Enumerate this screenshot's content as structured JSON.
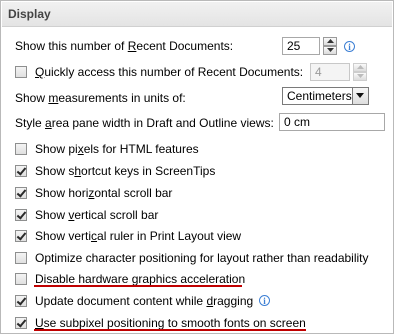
{
  "header": {
    "title": "Display"
  },
  "recent_docs": {
    "label_pre": "Show this number of ",
    "label_u": "R",
    "label_post": "ecent Documents:",
    "value": "25"
  },
  "quick_access": {
    "label_u": "Q",
    "label_post": "uickly access this number of Recent Documents:",
    "value": "4",
    "checked": false
  },
  "measurements": {
    "label_pre": "Show ",
    "label_u": "m",
    "label_post": "easurements in units of:",
    "selected": "Centimeters"
  },
  "style_area": {
    "label_pre": "Style ",
    "label_u": "a",
    "label_post": "rea pane width in Draft and Outline views:",
    "value": "0 cm"
  },
  "checkboxes": [
    {
      "pre": "Show pi",
      "u": "x",
      "post": "els for HTML features",
      "checked": false
    },
    {
      "pre": "Show s",
      "u": "h",
      "post": "ortcut keys in ScreenTips",
      "checked": true
    },
    {
      "pre": "Show hori",
      "u": "z",
      "post": "ontal scroll bar",
      "checked": true
    },
    {
      "pre": "Show ",
      "u": "v",
      "post": "ertical scroll bar",
      "checked": true
    },
    {
      "pre": "Show verti",
      "u": "c",
      "post": "al ruler in Print Layout view",
      "checked": true
    },
    {
      "pre": "Optimize character positioning for layout rather than readability",
      "u": "",
      "post": "",
      "checked": false
    },
    {
      "pre": "Disable hardware ",
      "u": "g",
      "post": "raphics acceleration",
      "checked": false
    },
    {
      "pre": "Update document content while ",
      "u": "d",
      "post": "ragging",
      "checked": true
    },
    {
      "pre": "",
      "u": "U",
      "post": "se subpixel positioning to smooth fonts on screen",
      "checked": true
    }
  ],
  "colors": {
    "highlight_underline": "#c00000",
    "info": "#3c7fd4"
  },
  "icons": {
    "info": "info-icon",
    "spin": "spin-arrows",
    "dropdown": "chevron-down-icon"
  }
}
